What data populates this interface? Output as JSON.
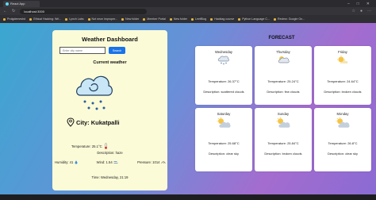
{
  "browser": {
    "tab_title": "React App",
    "url": "localhost:3000",
    "bookmarks": [
      "Prolgdemeshd",
      "Ethical Hacking: Wri...",
      "Lynch Labs",
      "Not neon improper...",
      "New folder",
      "Member Portal",
      "New folder",
      "LeetBlog",
      "Hacktag course",
      "Python Language C...",
      "Review: Google On..."
    ]
  },
  "app": {
    "title": "Weather Dashboard",
    "search": {
      "placeholder": "Enter city name",
      "value": "",
      "button_label": "Search"
    },
    "current": {
      "section_label": "Current weather",
      "city_text": "City: Kukatpalli",
      "temperature_text": "Temperature: 25.1°C",
      "description_text": "Description: haze",
      "humidity_text": "Humidity: 41",
      "wind_text": "Wind: 1.54",
      "pressure_text": "Pressure: 1014",
      "time_text": "Time: Wednesday, 21:19"
    },
    "forecast": {
      "title": "FORECAST",
      "days": [
        {
          "day": "Wednesday",
          "temperature": "Temperature: 26.37°C",
          "description": "Description: scattered clouds",
          "icon": "cloud-snow-icon"
        },
        {
          "day": "Thursday",
          "temperature": "Temperature: 25.24°C",
          "description": "Description: few clouds",
          "icon": "cloud-sun-icon"
        },
        {
          "day": "Friday",
          "temperature": "Temperature: 24.64°C",
          "description": "Description: broken clouds",
          "icon": "sun-cloud-icon"
        },
        {
          "day": "Saturday",
          "temperature": "Temperature: 25.68°C",
          "description": "Description: clear sky",
          "icon": "sun-cloud-icon"
        },
        {
          "day": "Sunday",
          "temperature": "Temperature: 25.84°C",
          "description": "Description: broken clouds",
          "icon": "sun-cloud-icon"
        },
        {
          "day": "Monday",
          "temperature": "Temperature: 26.8°C",
          "description": "Description: clear sky",
          "icon": "sun-cloud-icon"
        }
      ]
    }
  },
  "colors": {
    "search_button": "#1a73e8",
    "left_card": "#fbfbd8",
    "forecast_card": "#ffffff"
  }
}
